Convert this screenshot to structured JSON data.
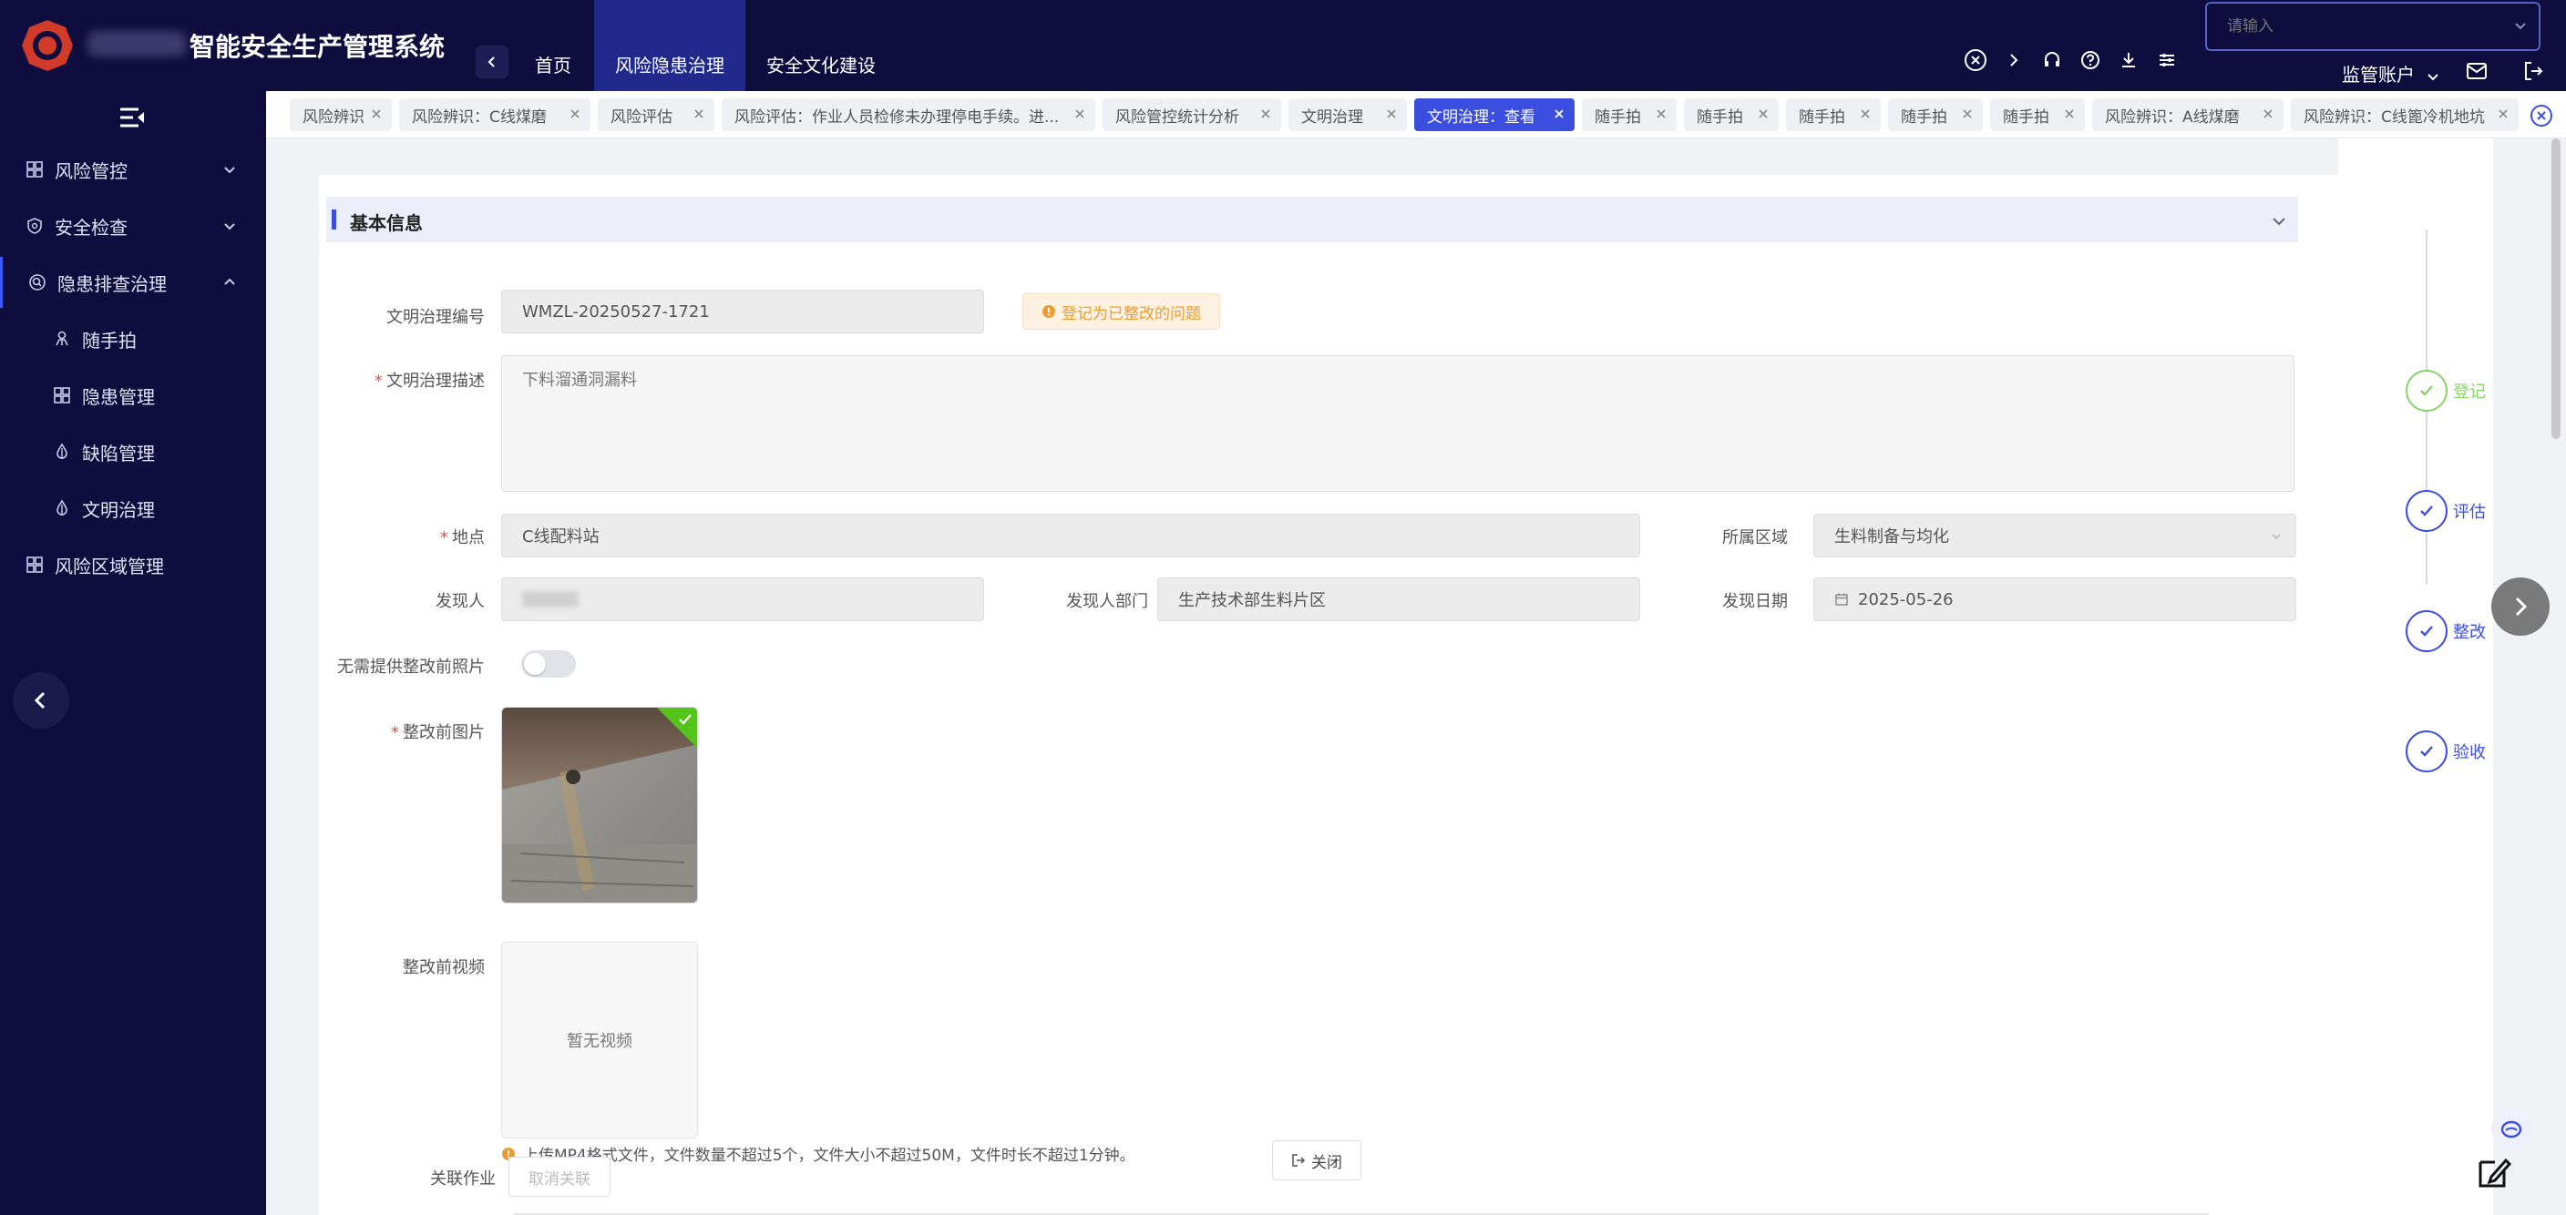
{
  "app": {
    "title": "智能安全生产管理系统",
    "nav": [
      "首页",
      "风险隐患治理",
      "安全文化建设"
    ],
    "search_placeholder": "请输入",
    "account": "监管账户",
    "colors": {
      "bg_dark": "#0e0d3d",
      "accent": "#3b4ee0",
      "success": "#8ad36a",
      "warning": "#e89d35"
    }
  },
  "sidebar": {
    "items": [
      {
        "label": "风险管控",
        "icon": "grid-icon"
      },
      {
        "label": "安全检查",
        "icon": "shield-icon"
      },
      {
        "label": "隐患排查治理",
        "icon": "search-icon"
      },
      {
        "label": "随手拍",
        "icon": "person-icon"
      },
      {
        "label": "隐患管理",
        "icon": "grid-icon"
      },
      {
        "label": "缺陷管理",
        "icon": "droplet-icon"
      },
      {
        "label": "文明治理",
        "icon": "droplet-icon"
      },
      {
        "label": "风险区域管理",
        "icon": "grid-icon"
      }
    ]
  },
  "tabs": [
    "风险辨识",
    "风险辨识：C线煤磨",
    "风险评估",
    "风险评估：作业人员检修未办理停电手续。进...",
    "风险管控统计分析",
    "文明治理",
    "文明治理：查看",
    "随手拍",
    "随手拍",
    "随手拍",
    "随手拍",
    "随手拍",
    "风险辨识：A线煤磨",
    "风险辨识：C线篦冷机地坑"
  ],
  "form": {
    "section_title": "基本信息",
    "labels": {
      "code": "文明治理编号",
      "desc": "文明治理描述",
      "location": "地点",
      "area": "所属区域",
      "finder": "发现人",
      "dept": "发现人部门",
      "date": "发现日期",
      "no_photo": "无需提供整改前照片",
      "before_photo": "整改前图片",
      "before_video": "整改前视频",
      "related": "关联作业"
    },
    "values": {
      "code": "WMZL-20250527-1721",
      "status_tag": "登记为已整改的问题",
      "desc": "下料溜通洞漏料",
      "location": "C线配料站",
      "area": "生料制备与均化",
      "finder": "",
      "dept": "生产技术部生料片区",
      "date": "2025-05-26",
      "no_video": "暂无视频",
      "upload_hint": "上传MP4格式文件，文件数量不超过5个，文件大小不超过50M，文件时长不超过1分钟。",
      "cancel_related": "取消关联",
      "close": "关闭"
    },
    "no_photo_toggle": false
  },
  "steps": [
    {
      "label": "登记",
      "state": "done"
    },
    {
      "label": "评估",
      "state": "active"
    },
    {
      "label": "整改",
      "state": "active"
    },
    {
      "label": "验收",
      "state": "active"
    }
  ]
}
